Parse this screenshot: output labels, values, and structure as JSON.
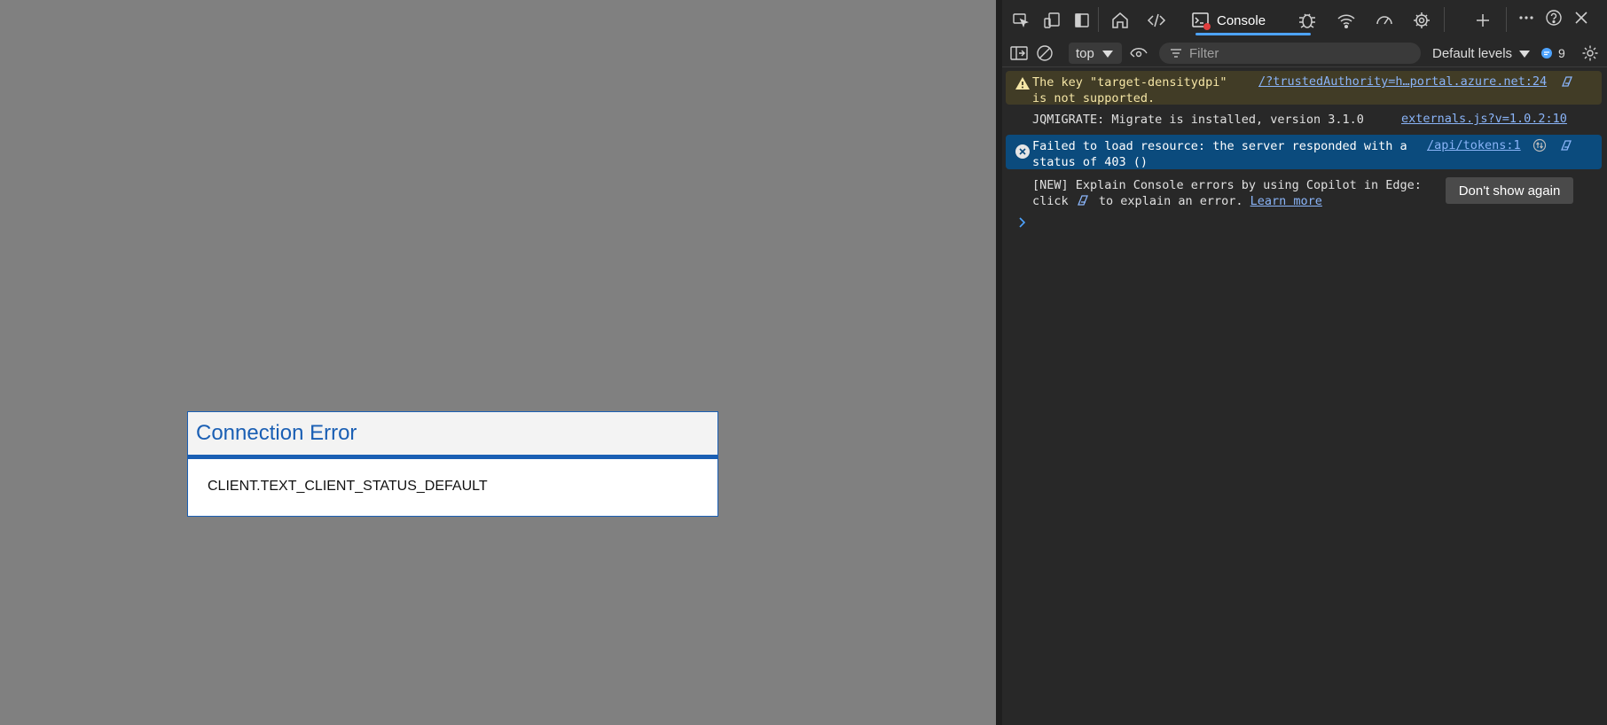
{
  "page": {
    "dialog": {
      "title": "Connection Error",
      "message": "CLIENT.TEXT_CLIENT_STATUS_DEFAULT"
    }
  },
  "devtools": {
    "toolbar": {
      "icons": [
        "inspect-icon",
        "device-emulation-icon",
        "dock-side-icon",
        "welcome-home-icon",
        "elements-icon",
        "console-icon",
        "sources-bug-icon",
        "network-wifi-icon",
        "performance-icon",
        "memory-chip-icon",
        "add-tool-icon",
        "more-icon",
        "help-icon",
        "close-icon"
      ],
      "console_tab_label": "Console"
    },
    "console_bar": {
      "context": "top",
      "filter_placeholder": "Filter",
      "levels_label": "Default levels",
      "message_count": "9"
    },
    "messages": {
      "warning": {
        "text": "The key \"target-densitydpi\"\nis not supported.",
        "source": "/?trustedAuthority=h…portal.azure.net:24"
      },
      "info": {
        "text": "JQMIGRATE: Migrate is installed, version 3.1.0",
        "source": "externals.js?v=1.0.2:10"
      },
      "error": {
        "text": "Failed to load resource: the server responded with a\nstatus of 403 ()",
        "source": "/api/tokens:1"
      },
      "copilot_tip": {
        "line1": "[NEW] Explain Console errors by using Copilot in Edge:",
        "line2_before": "click",
        "line2_after": "to explain an error.",
        "learn_more": "Learn more",
        "dismiss_label": "Don't show again"
      }
    },
    "colors": {
      "accent": "#4da3ff",
      "warning_bg": "#413c26",
      "error_bg": "#0b4b7d"
    }
  }
}
